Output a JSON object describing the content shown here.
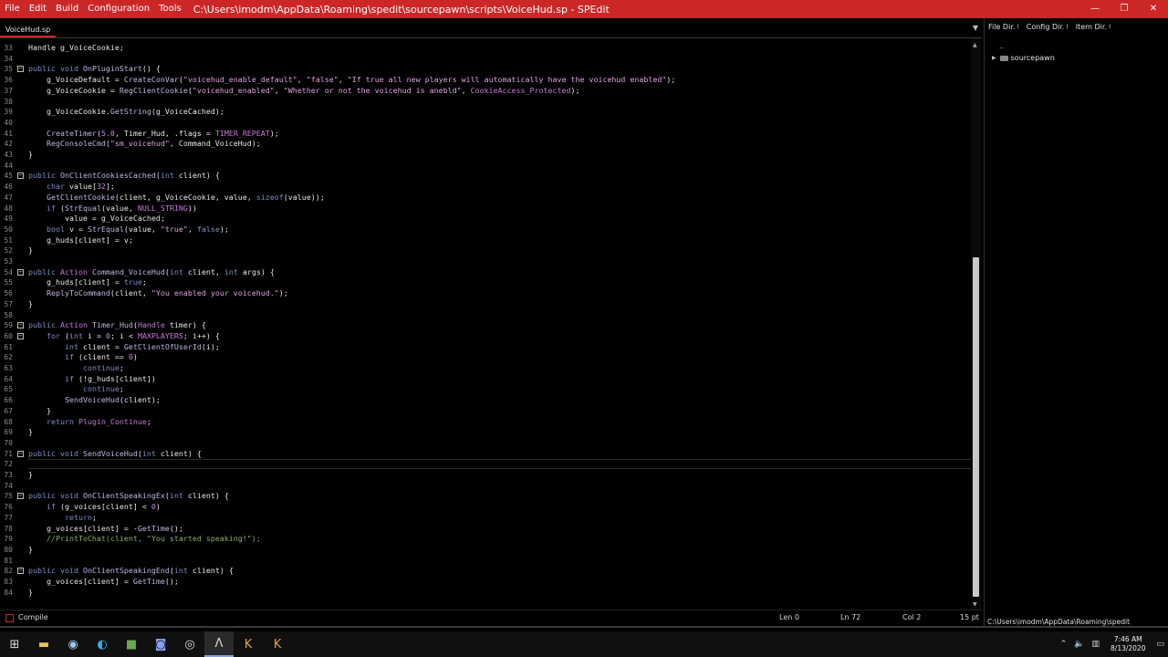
{
  "menu": [
    "File",
    "Edit",
    "Build",
    "Configuration",
    "Tools"
  ],
  "window": {
    "title": "C:\\Users\\imodm\\AppData\\Roaming\\spedit\\sourcepawn\\scripts\\VoiceHud.sp - SPEdit",
    "minimize": "—",
    "maximize": "❐",
    "close": "✕"
  },
  "tab": {
    "label": "VoiceHud.sp"
  },
  "code_lines": [
    {
      "n": "33",
      "fold": false,
      "html": "<span class='pl'>Handle g_VoiceCookie;</span>"
    },
    {
      "n": "34",
      "fold": false,
      "html": ""
    },
    {
      "n": "35",
      "fold": true,
      "html": "<span class='kw'>public void</span> <span class='fn'>OnPluginStart</span>() {"
    },
    {
      "n": "36",
      "fold": false,
      "html": "    g_VoiceDefault = <span class='fn'>CreateConVar</span>(<span class='str'>\"voicehud_enable_default\"</span>, <span class='str'>\"false\"</span>, <span class='str'>\"If true all new players will automatically have the voicehud enabled\"</span>);"
    },
    {
      "n": "37",
      "fold": false,
      "html": "    g_VoiceCookie = <span class='fn'>RegClientCookie</span>(<span class='str'>\"voicehud_enabled\"</span>, <span class='str'>\"Whether or not the voicehud is anebld\"</span>, <span class='cst'>CookieAccess_Protected</span>);"
    },
    {
      "n": "38",
      "fold": false,
      "html": ""
    },
    {
      "n": "39",
      "fold": false,
      "html": "    g_VoiceCookie.<span class='fn'>GetString</span>(g_VoiceCached);"
    },
    {
      "n": "40",
      "fold": false,
      "html": ""
    },
    {
      "n": "41",
      "fold": false,
      "html": "    <span class='fn'>CreateTimer</span>(<span class='num'>5.0</span>, Timer_Hud, .flags = <span class='cst'>TIMER_REPEAT</span>);"
    },
    {
      "n": "42",
      "fold": false,
      "html": "    <span class='fn'>RegConsoleCmd</span>(<span class='str'>\"sm_voicehud\"</span>, Command_VoiceHud);"
    },
    {
      "n": "43",
      "fold": false,
      "html": "}"
    },
    {
      "n": "44",
      "fold": false,
      "html": ""
    },
    {
      "n": "45",
      "fold": true,
      "html": "<span class='kw'>public</span> <span class='fn'>OnClientCookiesCached</span>(<span class='kw'>int</span> client) {"
    },
    {
      "n": "46",
      "fold": false,
      "html": "    <span class='kw'>char</span> value[<span class='num'>32</span>];"
    },
    {
      "n": "47",
      "fold": false,
      "html": "    <span class='fn'>GetClientCookie</span>(client, g_VoiceCookie, value, <span class='kw'>sizeof</span>(value));"
    },
    {
      "n": "48",
      "fold": false,
      "html": "    <span class='kw'>if</span> (<span class='fn'>StrEqual</span>(value, <span class='cst'>NULL_STRING</span>))"
    },
    {
      "n": "49",
      "fold": false,
      "html": "        value = g_VoiceCached;"
    },
    {
      "n": "50",
      "fold": false,
      "html": "    <span class='kw'>bool</span> v = <span class='fn'>StrEqual</span>(value, <span class='str'>\"true\"</span>, <span class='kw'>false</span>);"
    },
    {
      "n": "51",
      "fold": false,
      "html": "    g_huds[client] = v;"
    },
    {
      "n": "52",
      "fold": false,
      "html": "}"
    },
    {
      "n": "53",
      "fold": false,
      "html": ""
    },
    {
      "n": "54",
      "fold": true,
      "html": "<span class='kw'>public</span> <span class='cst'>Action</span> <span class='fn'>Command_VoiceHud</span>(<span class='kw'>int</span> client, <span class='kw'>int</span> args) {"
    },
    {
      "n": "55",
      "fold": false,
      "html": "    g_huds[client] = <span class='kw'>true</span>;"
    },
    {
      "n": "56",
      "fold": false,
      "html": "    <span class='fn'>ReplyToCommand</span>(client, <span class='str'>\"You enabled your voicehud.\"</span>);"
    },
    {
      "n": "57",
      "fold": false,
      "html": "}"
    },
    {
      "n": "58",
      "fold": false,
      "html": ""
    },
    {
      "n": "59",
      "fold": true,
      "html": "<span class='kw'>public</span> <span class='cst'>Action</span> <span class='fn'>Timer_Hud</span>(<span class='cst'>Handle</span> timer) {"
    },
    {
      "n": "60",
      "fold": true,
      "html": "    <span class='kw'>for</span> (<span class='kw'>int</span> i = <span class='num'>0</span>; i &lt; <span class='cst'>MAXPLAYERS</span>; i++) {"
    },
    {
      "n": "61",
      "fold": false,
      "html": "        <span class='kw'>int</span> client = <span class='fn'>GetClientOfUserId</span>(i);"
    },
    {
      "n": "62",
      "fold": false,
      "html": "        <span class='kw'>if</span> (client == <span class='num'>0</span>)"
    },
    {
      "n": "63",
      "fold": false,
      "html": "            <span class='kw'>continue</span>;"
    },
    {
      "n": "64",
      "fold": false,
      "html": "        <span class='kw'>if</span> (!g_huds[client])"
    },
    {
      "n": "65",
      "fold": false,
      "html": "            <span class='kw'>continue</span>;"
    },
    {
      "n": "66",
      "fold": false,
      "html": "        <span class='fn'>SendVoiceHud</span>(client);"
    },
    {
      "n": "67",
      "fold": false,
      "html": "    }"
    },
    {
      "n": "68",
      "fold": false,
      "html": "    <span class='kw'>return</span> <span class='cst'>Plugin_Continue</span>;"
    },
    {
      "n": "69",
      "fold": false,
      "html": "}"
    },
    {
      "n": "70",
      "fold": false,
      "html": ""
    },
    {
      "n": "71",
      "fold": true,
      "html": "<span class='kw'>public void</span> <span class='fn'>SendVoiceHud</span>(<span class='kw'>int</span> client) {"
    },
    {
      "n": "72",
      "fold": false,
      "html": ""
    },
    {
      "n": "73",
      "fold": false,
      "html": "}"
    },
    {
      "n": "74",
      "fold": false,
      "html": ""
    },
    {
      "n": "75",
      "fold": true,
      "html": "<span class='kw'>public void</span> <span class='fn'>OnClientSpeakingEx</span>(<span class='kw'>int</span> client) {"
    },
    {
      "n": "76",
      "fold": false,
      "html": "    <span class='kw'>if</span> (g_voices[client] &lt; <span class='num'>0</span>)"
    },
    {
      "n": "77",
      "fold": false,
      "html": "        <span class='kw'>return</span>;"
    },
    {
      "n": "78",
      "fold": false,
      "html": "    g_voices[client] = -<span class='fn'>GetTime</span>();"
    },
    {
      "n": "79",
      "fold": false,
      "html": "    <span class='cmt'>//PrintToChat(client, \"You started speaking!\");</span>"
    },
    {
      "n": "80",
      "fold": false,
      "html": "}"
    },
    {
      "n": "81",
      "fold": false,
      "html": ""
    },
    {
      "n": "82",
      "fold": true,
      "html": "<span class='kw'>public void</span> <span class='fn'>OnClientSpeakingEnd</span>(<span class='kw'>int</span> client) {"
    },
    {
      "n": "83",
      "fold": false,
      "html": "    g_voices[client] = <span class='fn'>GetTime</span>();"
    },
    {
      "n": "84",
      "fold": false,
      "html": "}"
    }
  ],
  "right_panel": {
    "tabs": [
      "File Dir.",
      "Config Dir.",
      "Item Dir."
    ],
    "parent": "..",
    "tree_item": "sourcepawn",
    "footer_path": "C:\\Users\\imodm\\AppData\\Roaming\\spedit"
  },
  "status": {
    "compile": "Compile",
    "len": "Len 0",
    "ln": "Ln 72",
    "col": "Col 2",
    "pt": "15 pt"
  },
  "clock": {
    "time": "7:46 AM",
    "date": "8/13/2020"
  },
  "icons": [
    "windows-start-icon",
    "file-explorer-icon",
    "steam-icon",
    "edge-icon",
    "minecraft-icon",
    "discord-icon",
    "obs-icon",
    "spedit-icon",
    "counter-strike-icon",
    "counter-strike-icon-2"
  ]
}
